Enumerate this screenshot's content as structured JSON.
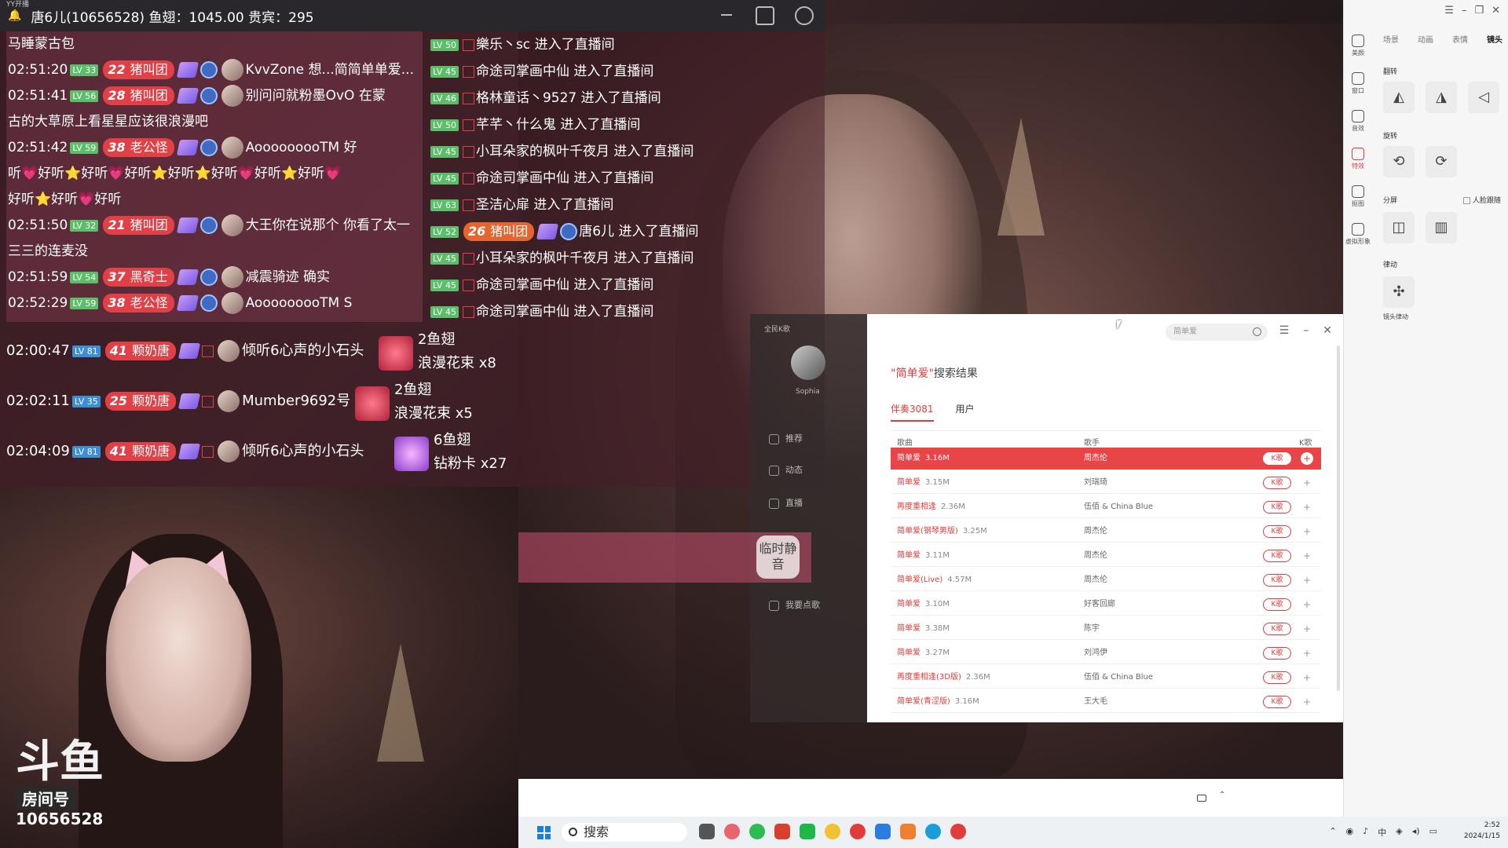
{
  "titlebar": {
    "app_name": "YY开播",
    "text": "唐6儿(10656528) 鱼翅：1045.00 贵宾：295"
  },
  "chat_left": [
    {
      "time": "",
      "text": "马睡蒙古包"
    },
    {
      "time": "02:51:20",
      "lv": "LV 33",
      "badge_num": "22",
      "badge": "猪叫团",
      "user": "KvvZone",
      "msg": "想...简简单单爱..."
    },
    {
      "time": "02:51:41",
      "lv": "LV 56",
      "badge_num": "28",
      "badge": "猪叫团",
      "user": "别问问就粉墨OvO",
      "msg": "在蒙"
    },
    {
      "time": "",
      "text": "古的大草原上看星星应该很浪漫吧"
    },
    {
      "time": "02:51:42",
      "lv": "LV 59",
      "badge_num": "38",
      "badge": "老公怪",
      "user": "AooooooooTM",
      "msg": "好"
    },
    {
      "time": "",
      "text": "听💗好听⭐好听💗好听⭐好听⭐好听💗好听⭐好听💗"
    },
    {
      "time": "",
      "text": "好听⭐好听💗好听"
    },
    {
      "time": "02:51:50",
      "lv": "LV 32",
      "badge_num": "21",
      "badge": "猪叫团",
      "user": "大王你在说那个",
      "msg": "你看了太一"
    },
    {
      "time": "",
      "text": "三三的连麦没"
    },
    {
      "time": "02:51:59",
      "lv": "LV 54",
      "badge_num": "37",
      "badge": "黑奇士",
      "user": "减震骑迹",
      "msg": "确实"
    },
    {
      "time": "02:52:29",
      "lv": "LV 59",
      "badge_num": "38",
      "badge": "老公怪",
      "user": "AooooooooTM",
      "msg": "S"
    }
  ],
  "chat_right": [
    {
      "lv": "LV 50",
      "user": "樂乐丶sc",
      "msg": "进入了直播间"
    },
    {
      "lv": "LV 45",
      "user": "命途司掌画中仙",
      "msg": "进入了直播间"
    },
    {
      "lv": "LV 46",
      "user": "格林童话丶9527",
      "msg": "进入了直播间"
    },
    {
      "lv": "LV 50",
      "user": "芊芊丶什么鬼",
      "msg": "进入了直播间"
    },
    {
      "lv": "LV 45",
      "user": "小耳朵家的枫叶千夜月",
      "msg": "进入了直播间"
    },
    {
      "lv": "LV 45",
      "user": "命途司掌画中仙",
      "msg": "进入了直播间"
    },
    {
      "lv": "LV 63",
      "user": "圣洁心扉",
      "msg": "进入了直播间"
    },
    {
      "lv": "LV 52",
      "badge_num": "26",
      "badge": "猪叫团",
      "user": "唐6儿",
      "msg": "进入了直播间"
    },
    {
      "lv": "LV 45",
      "user": "小耳朵家的枫叶千夜月",
      "msg": "进入了直播间"
    },
    {
      "lv": "LV 45",
      "user": "命途司掌画中仙",
      "msg": "进入了直播间"
    },
    {
      "lv": "LV 45",
      "user": "命途司掌画中仙",
      "msg": "进入了直播间"
    }
  ],
  "gifts": [
    {
      "time": "02:00:47",
      "lv": "LV 81",
      "badge_num": "41",
      "badge": "颗奶唐",
      "user": "倾听6心声的小石头",
      "gift": "2鱼翅",
      "gift2": "浪漫花束 x8"
    },
    {
      "time": "02:02:11",
      "lv": "LV 35",
      "badge_num": "25",
      "badge": "颗奶唐",
      "user": "Mumber9692号",
      "gift": "2鱼翅",
      "gift2": "浪漫花束 x5"
    },
    {
      "time": "02:04:09",
      "lv": "LV 81",
      "badge_num": "41",
      "badge": "颗奶唐",
      "user": "倾听6心声的小石头",
      "gift": "6鱼翅",
      "gift2": "钻粉卡 x27"
    }
  ],
  "room": {
    "logo": "斗鱼",
    "label": "房间号",
    "number": "10656528"
  },
  "mute": {
    "label": "临时静音"
  },
  "side_menu": {
    "title": "全民K歌",
    "user": "Sophia",
    "items": [
      "推荐",
      "动态",
      "直播",
      "我要点歌"
    ]
  },
  "song_window": {
    "search_placeholder": "简单爱",
    "result_keyword": "\"简单爱\"",
    "result_suffix": "搜索结果",
    "tabs": [
      "伴奏3081",
      "用户"
    ],
    "columns": [
      "歌曲",
      "歌手",
      "K歌"
    ],
    "k_label": "K歌",
    "songs": [
      {
        "name": "简单爱",
        "size": "3.16M",
        "singer": "周杰伦"
      },
      {
        "name": "简单爱",
        "size": "3.15M",
        "singer": "刘瑞琦"
      },
      {
        "name": "再度重相逢",
        "size": "2.36M",
        "singer": "伍佰 & China Blue"
      },
      {
        "name": "简单爱(钢琴男版)",
        "size": "3.25M",
        "singer": "周杰伦"
      },
      {
        "name": "简单爱",
        "size": "3.11M",
        "singer": "周杰伦"
      },
      {
        "name": "简单爱(Live)",
        "size": "4.57M",
        "singer": "周杰伦"
      },
      {
        "name": "简单爱",
        "size": "3.10M",
        "singer": "好客回廊"
      },
      {
        "name": "简单爱",
        "size": "3.38M",
        "singer": "陈宇"
      },
      {
        "name": "简单爱",
        "size": "3.27M",
        "singer": "刘鸿伊"
      },
      {
        "name": "再度重相逢(3D版)",
        "size": "2.36M",
        "singer": "伍佰 & China Blue"
      },
      {
        "name": "简单爱(青涩版)",
        "size": "3.16M",
        "singer": "王大毛"
      }
    ]
  },
  "ctrl_panel": {
    "rail": [
      "美颜",
      "窗口",
      "音效",
      "特效",
      "抠图",
      "虚拟形象"
    ],
    "tabs": [
      "场景",
      "动画",
      "表情",
      "镜头"
    ],
    "sections": {
      "flip": "翻转",
      "rotate": "旋转",
      "split": "分屏",
      "face_track": "人脸跟随",
      "motion": "律动",
      "motion_btn": "镜头律动"
    }
  },
  "taskbar": {
    "search": "搜索",
    "time": "2:52",
    "date": "2024/1/15",
    "ime": "中"
  }
}
